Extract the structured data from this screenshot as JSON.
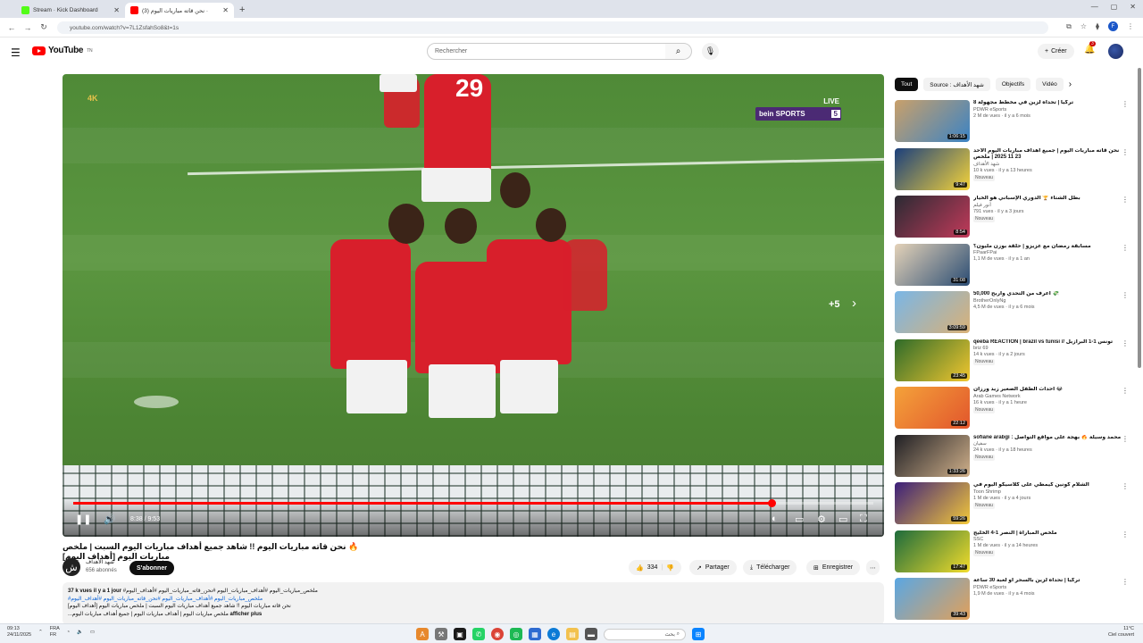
{
  "browser": {
    "tabs": [
      {
        "label": "Stream · Kick Dashboard",
        "icon": "kick-icon",
        "active": false
      },
      {
        "label": "(3) نحن قاته مباريات اليوم ·",
        "icon": "youtube-icon",
        "active": true
      }
    ],
    "url": "youtube.com/watch?v=7L1ZsfahSo8&t=1s"
  },
  "header": {
    "logo_text": "YouTube",
    "logo_sup": "TN",
    "search_placeholder": "Rechercher",
    "create_label": "Créer",
    "notifications_count": "3"
  },
  "player": {
    "watermark": "4K",
    "live_label": "LIVE",
    "channel_logo": "bein SPORTS",
    "channel_number": "5",
    "more_count": "+5",
    "time_current": "8:38",
    "time_total": "9:53",
    "progress": 0.873
  },
  "video": {
    "title": "🔥 نحن قاته مباريات اليوم !! شاهد جميع أهداف مباريات اليوم السبت | ملخص مباريات اليوم [أهداف اليوم]",
    "channel_name": "شهد الأهداف",
    "channel_avatar": "ش",
    "subscribers": "656 abonnés",
    "subscribe_label": "S'abonner",
    "likes": "334",
    "share_label": "Partager",
    "download_label": "Télécharger",
    "save_label": "Enregistrer"
  },
  "description": {
    "stats": "37 k vues  il y a 1 jour",
    "hashtags": "#ملخص_مباريات_اليوم #أهداف_مباريات_اليوم #نحن_قاته_مباريات_اليوم #أهداف_اليوم",
    "line2": "نحن قاته مباريات اليوم !! شاهد جميع أهداف مباريات اليوم السبت | ملخص مباريات اليوم [أهداف اليوم]",
    "line3": "...ملخص مباريات اليوم | أهداف مباريات اليوم | جميع أهداف مباريات اليوم",
    "more_label": "afficher plus"
  },
  "chips": [
    "Tout",
    "Source : شهد الأهداف",
    "Objectifs",
    "Vidéo"
  ],
  "recommendations": [
    {
      "title": "تركيا | تحداه لزين في مخطط مجهولة 8",
      "channel": "PDWR eSports",
      "meta": "2 M de vues · il y a 6 mois",
      "duration": "1:06:15",
      "badge": "",
      "c1": "#c9a06a",
      "c2": "#3b83c4"
    },
    {
      "title": "نحن قاته مباريات اليوم | جميع أهداف مباريات اليوم الأحد 23 11 2025 | ملخص",
      "channel": "شهد الأهداف",
      "meta": "10 k vues · il y a 13 heures",
      "duration": "9:47",
      "badge": "Nouveau",
      "c1": "#1b3f7c",
      "c2": "#f4d33a"
    },
    {
      "title": "بطل الشتاء 🏆 الدوري الإسباني هو الخيار",
      "channel": "أنور فيلم",
      "meta": "791 vues · il y a 3 jours",
      "duration": "8:54",
      "badge": "Nouveau",
      "c1": "#2a2a33",
      "c2": "#c23a5a"
    },
    {
      "title": "مسابقة رمضان مع عزيزو | حلقة بوزن مليون؟",
      "channel": "FPaarFPai",
      "meta": "1,1 M de vues · il y a 1 an",
      "duration": "31:08",
      "badge": "",
      "c1": "#e4d2b8",
      "c2": "#2b4d74"
    },
    {
      "title": "أعرف من التحدي واربح 50,000 💸",
      "channel": "BrotherOnlyNg",
      "meta": "4,5 M de vues · il y a 6 mois",
      "duration": "3:09:59",
      "badge": "",
      "c1": "#7ab6e6",
      "c2": "#d9b177"
    },
    {
      "title": "qeeba REACTION | brazil vs tunisi // تونس 1-1 البرازيل",
      "channel": "briz 69",
      "meta": "14 k vues · il y a 2 jours",
      "duration": "23:45",
      "badge": "Nouveau",
      "c1": "#2e6b2a",
      "c2": "#f1c62f"
    },
    {
      "title": "أحداث الطفل الصغير زيد ورزان 😂",
      "channel": "Arab Games Network",
      "meta": "16 k vues · il y a 1 heure",
      "duration": "22:12",
      "badge": "Nouveau",
      "c1": "#f4a23a",
      "c2": "#e2562c"
    },
    {
      "title": "sofiane arabgi : محمد وسيلة 🔥 بهجة على مواقع التواصل",
      "channel": "سفيان",
      "meta": "24 k vues · il y a 18 heures",
      "duration": "1:33:26",
      "badge": "Nouveau",
      "c1": "#1f1f24",
      "c2": "#d0b08a"
    },
    {
      "title": "الشلام كونين كيمطي على كلاسيكو اليوم في",
      "channel": "Toon Shrimp",
      "meta": "1 M de vues · il y a 4 jours",
      "duration": "59:26",
      "badge": "Nouveau",
      "c1": "#3c1f7b",
      "c2": "#f3c83a"
    },
    {
      "title": "ملخص المباراة | النصر 1-4 الخليج",
      "channel": "SSC",
      "meta": "1 M de vues · il y a 14 heures",
      "duration": "17:47",
      "badge": "Nouveau",
      "c1": "#1d6b3c",
      "c2": "#f2dc2c"
    },
    {
      "title": "تركيا | تحداه لزين بالسحر أو لعبة 30 ساعة",
      "channel": "PDWR eSports",
      "meta": "1,9 M de vues · il y a 4 mois",
      "duration": "39:43",
      "badge": "",
      "c1": "#5aa7e3",
      "c2": "#e1a05a"
    }
  ],
  "taskbar": {
    "time": "09:13",
    "date": "24/11/2025",
    "lang": "FRA",
    "lang2": "FR",
    "search_placeholder": "بحث",
    "weather_temp": "11°C",
    "weather_text": "Ciel couvert"
  }
}
